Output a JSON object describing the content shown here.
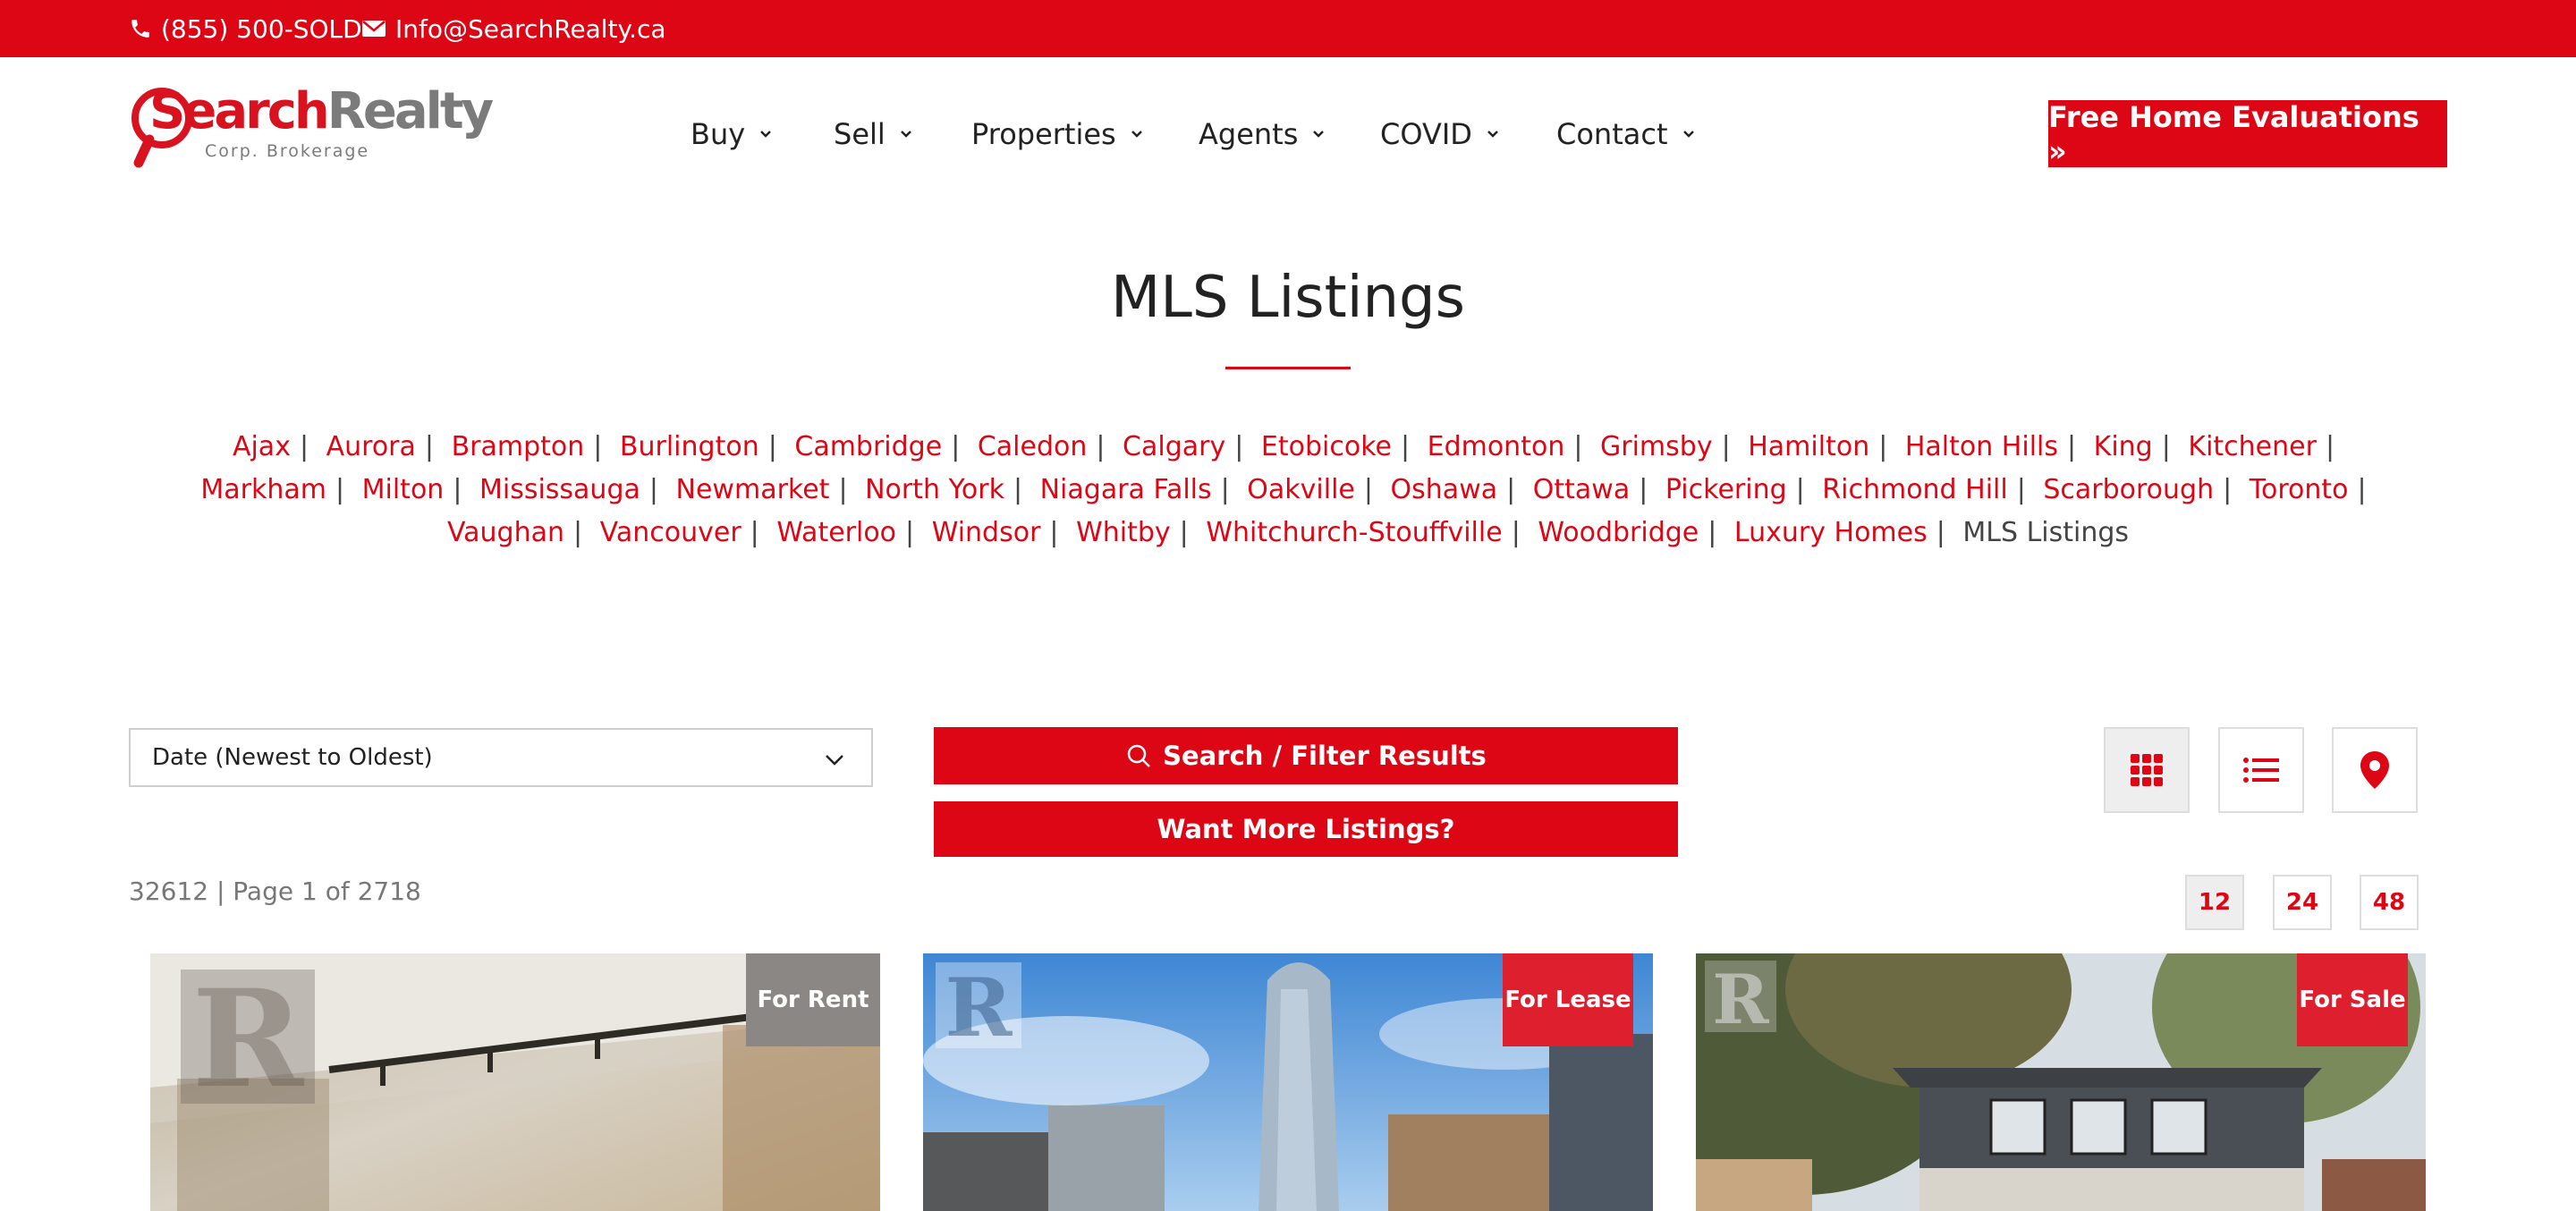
{
  "topbar": {
    "phone": "(855) 500-SOLD",
    "email": "Info@SearchRealty.ca",
    "bg_color": "#dd0615"
  },
  "logo": {
    "part1": "Search",
    "part2": "Realty",
    "sub": "Corp. Brokerage"
  },
  "nav": {
    "items": [
      {
        "label": "Buy"
      },
      {
        "label": "Sell"
      },
      {
        "label": "Properties"
      },
      {
        "label": "Agents"
      },
      {
        "label": "COVID"
      },
      {
        "label": "Contact"
      }
    ],
    "cta": "Free Home Evaluations »"
  },
  "page": {
    "title": "MLS Listings"
  },
  "cities": {
    "links": [
      "Ajax",
      "Aurora",
      "Brampton",
      "Burlington",
      "Cambridge",
      "Caledon",
      "Calgary",
      "Etobicoke",
      "Edmonton",
      "Grimsby",
      "Hamilton",
      "Halton Hills",
      "King",
      "Kitchener",
      "Markham",
      "Milton",
      "Mississauga",
      "Newmarket",
      "North York",
      "Niagara Falls",
      "Oakville",
      "Oshawa",
      "Ottawa",
      "Pickering",
      "Richmond Hill",
      "Scarborough",
      "Toronto",
      "Vaughan",
      "Vancouver",
      "Waterloo",
      "Windsor",
      "Whitby",
      "Whitchurch-Stouffville",
      "Woodbridge",
      "Luxury Homes"
    ],
    "current": "MLS Listings",
    "separator": "|"
  },
  "controls": {
    "sort_value": "Date (Newest to Oldest)",
    "search_button": "Search / Filter Results",
    "more_button": "Want More Listings?",
    "count_text": "32612 | Page 1 of 2718",
    "per_page": [
      "12",
      "24",
      "48"
    ],
    "per_page_selected": "12",
    "view_modes": [
      "grid-icon",
      "list-icon",
      "map-pin-icon"
    ],
    "view_selected": "grid-icon"
  },
  "listings": [
    {
      "badge": "For Rent",
      "badge_color": "#8a8784"
    },
    {
      "badge": "For Lease",
      "badge_color": "#dd1f2e"
    },
    {
      "badge": "For Sale",
      "badge_color": "#dd1f2e"
    }
  ],
  "watermark": "REALTOR"
}
